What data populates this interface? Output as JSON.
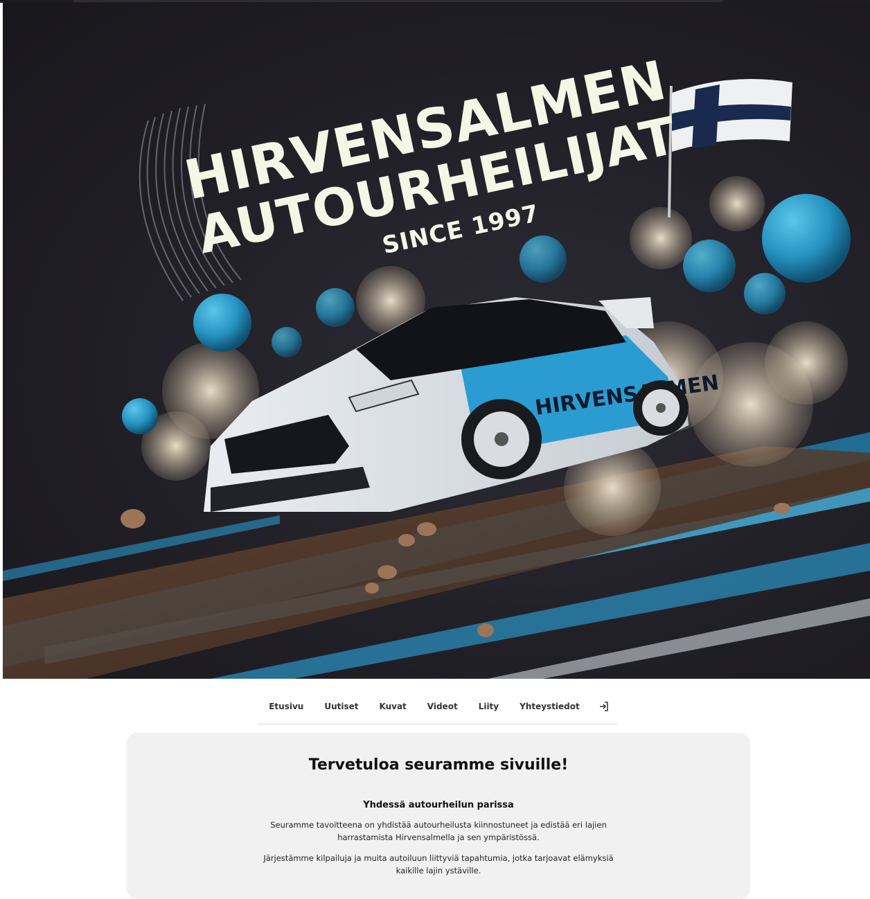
{
  "hero": {
    "title_line1": "HIRVENSALMEN",
    "title_line2": "AUTOURHEILIJAT",
    "since": "SINCE 1997",
    "car_text": "HIRVENSALMEN",
    "colors": {
      "accent": "#2fa6d6",
      "background": "#211f26",
      "title": "#f4f6e6"
    }
  },
  "nav": {
    "items": [
      "Etusivu",
      "Uutiset",
      "Kuvat",
      "Videot",
      "Liity",
      "Yhteystiedot"
    ],
    "login_icon": "login-icon"
  },
  "content": {
    "heading": "Tervetuloa seuramme sivuille!",
    "subheading": "Yhdessä autourheilun parissa",
    "paragraph1": "Seuramme tavoitteena on yhdistää autourheilusta kiinnostuneet ja edistää eri lajien harrastamista Hirvensalmella ja sen ympäristössä.",
    "paragraph2": "Järjestämme kilpailuja ja muita autoiluun liittyviä tapahtumia, jotka tarjoavat elämyksiä kaikille lajin ystäville."
  }
}
